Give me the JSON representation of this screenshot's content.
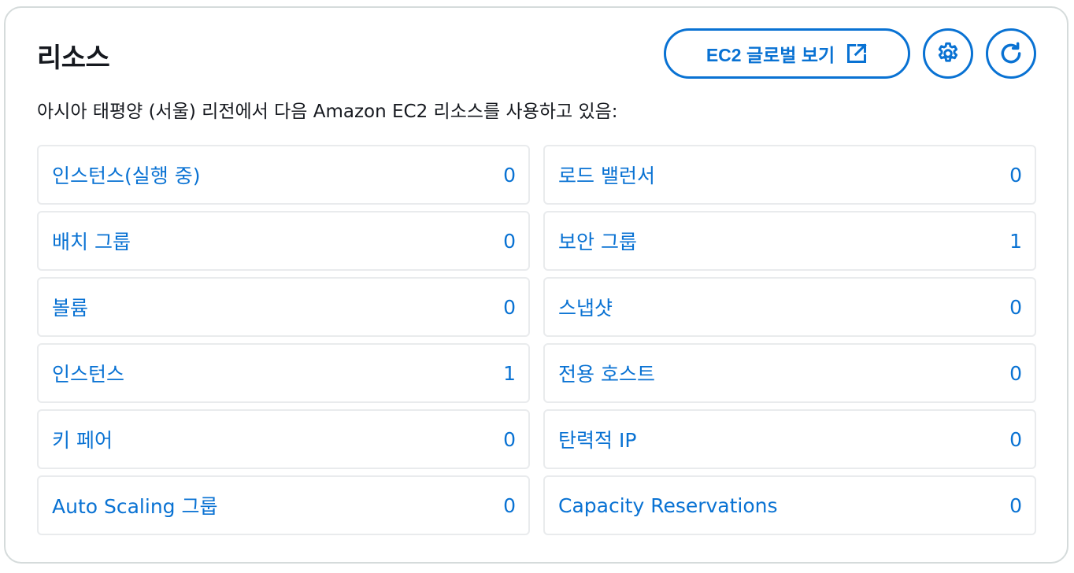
{
  "title": "리소스",
  "subtitle": "아시아 태평양 (서울) 리전에서 다음 Amazon EC2 리소스를 사용하고 있음:",
  "buttons": {
    "global_view_label": "EC2 글로벌 보기",
    "global_view_icon": "external-link-icon",
    "settings_icon": "gear-icon",
    "refresh_icon": "refresh-icon"
  },
  "colors": {
    "accent": "#0972d3",
    "border": "#d5dbdb",
    "cell_border": "#e9ebed",
    "text": "#16191f"
  },
  "resources": [
    {
      "label": "인스턴스(실행 중)",
      "count": "0"
    },
    {
      "label": "로드 밸런서",
      "count": "0"
    },
    {
      "label": "배치 그룹",
      "count": "0"
    },
    {
      "label": "보안 그룹",
      "count": "1"
    },
    {
      "label": "볼륨",
      "count": "0"
    },
    {
      "label": "스냅샷",
      "count": "0"
    },
    {
      "label": "인스턴스",
      "count": "1"
    },
    {
      "label": "전용 호스트",
      "count": "0"
    },
    {
      "label": "키 페어",
      "count": "0"
    },
    {
      "label": "탄력적 IP",
      "count": "0"
    },
    {
      "label": "Auto Scaling 그룹",
      "count": "0"
    },
    {
      "label": "Capacity Reservations",
      "count": "0"
    }
  ]
}
